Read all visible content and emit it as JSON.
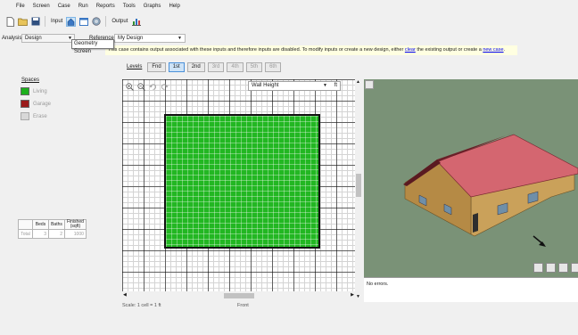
{
  "menu": [
    "File",
    "Screen",
    "Case",
    "Run",
    "Reports",
    "Tools",
    "Graphs",
    "Help"
  ],
  "toolbar": {
    "input_label": "Input",
    "output_label": "Output"
  },
  "analysis": {
    "label": "Analysis:",
    "value": "Design"
  },
  "reference": {
    "label": "Reference:",
    "value": "My Design"
  },
  "tooltip": "Geometry Screen",
  "notice": {
    "text_before": "This case contains output associated with these inputs and therefore inputs are disabled. To modify inputs or create a new design, either",
    "link_clear": "clear",
    "text_middle": "the existing output or create a",
    "link_new_case": "new case",
    "text_after": "."
  },
  "levels": {
    "label": "Levels",
    "buttons": [
      "Fnd",
      "1st",
      "2nd",
      "3rd",
      "4th",
      "5th",
      "6th"
    ],
    "selected": "1st"
  },
  "spaces": {
    "title": "Spaces",
    "items": [
      {
        "label": "Living",
        "color": "#1db01d"
      },
      {
        "label": "Garage",
        "color": "#9b1c1c"
      },
      {
        "label": "Erase",
        "color": "#d8d8d8"
      }
    ]
  },
  "summary": {
    "headers": [
      "",
      "Beds",
      "Baths",
      "Finished (sqft)"
    ],
    "row": {
      "label": "Total",
      "beds": "3",
      "baths": "2",
      "sqft": "1000"
    }
  },
  "wall_height": {
    "value": "Wall Height",
    "unit": "ft"
  },
  "canvas_footer": {
    "scale": "Scale: 1 cell = 1 ft",
    "front": "Front"
  },
  "errors_text": "No errors."
}
